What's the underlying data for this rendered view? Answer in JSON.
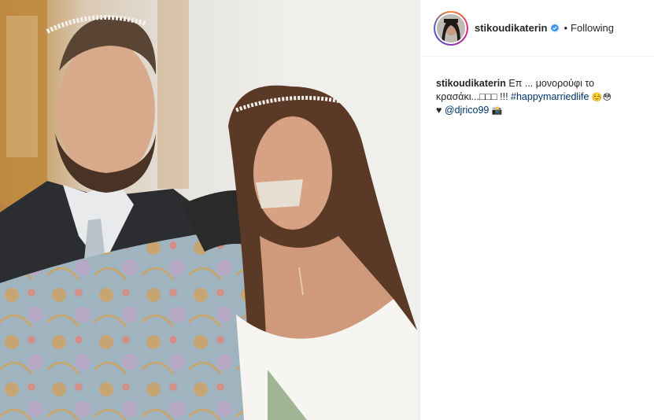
{
  "post": {
    "username": "stikoudikaterin",
    "verified_icon": "verified-badge-icon",
    "separator": "•",
    "follow_status": "Following",
    "caption": {
      "username": "stikoudikaterin",
      "line1": "Επ ... μονορούφι το",
      "line2_start": "κρασάκι...",
      "line2_boxes": "□□□",
      "line2_excl": "!!!",
      "hashtag": "#happymarriedlife",
      "emoji1": "☺️😳",
      "heart": "♥",
      "mention": "@djrico99",
      "emoji2": "📸"
    }
  },
  "colors": {
    "link": "#003569",
    "verified": "#3897f0",
    "text": "#262626"
  }
}
